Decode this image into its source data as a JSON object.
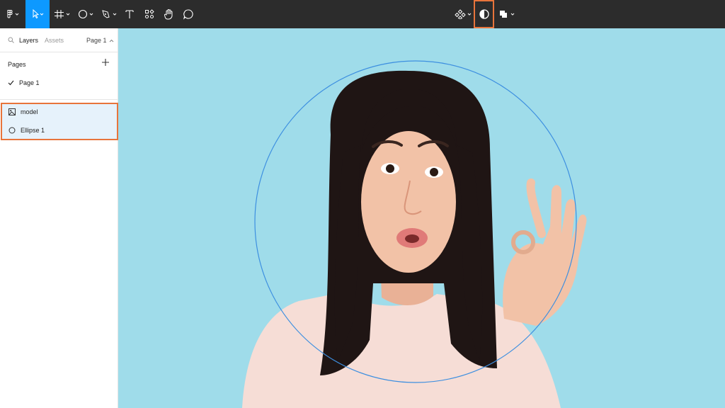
{
  "toolbar": {
    "tools": [
      {
        "name": "main-menu",
        "icon": "figma-logo-icon"
      },
      {
        "name": "move-tool",
        "icon": "cursor-icon",
        "active": true
      },
      {
        "name": "frame-tool",
        "icon": "frame-hash-icon"
      },
      {
        "name": "shape-tool",
        "icon": "ellipse-icon"
      },
      {
        "name": "pen-tool",
        "icon": "pen-nib-icon"
      },
      {
        "name": "text-tool",
        "icon": "text-t-icon"
      },
      {
        "name": "resources-tool",
        "icon": "resources-grid-icon"
      },
      {
        "name": "hand-tool",
        "icon": "hand-icon"
      },
      {
        "name": "comment-tool",
        "icon": "comment-bubble-icon"
      }
    ],
    "center_tools": [
      {
        "name": "component",
        "icon": "component-diamond-icon"
      },
      {
        "name": "mask",
        "icon": "mask-contrast-icon",
        "highlighted": true
      },
      {
        "name": "boolean",
        "icon": "boolean-union-icon"
      }
    ],
    "active_color": "#0d99ff",
    "highlight_color": "#e8743b"
  },
  "sidebar": {
    "tabs": {
      "layers": "Layers",
      "assets": "Assets",
      "page_selector": "Page 1"
    },
    "pages_heading": "Pages",
    "pages": [
      {
        "label": "Page 1",
        "selected": true
      }
    ],
    "layers": [
      {
        "label": "model",
        "icon": "image-icon"
      },
      {
        "label": "Ellipse 1",
        "icon": "ellipse-icon"
      }
    ]
  },
  "canvas": {
    "background_color": "#9fdcea",
    "image_subject": "photo-of-woman-making-ok-gesture",
    "ellipse_stroke_color": "#3d8fe0"
  }
}
